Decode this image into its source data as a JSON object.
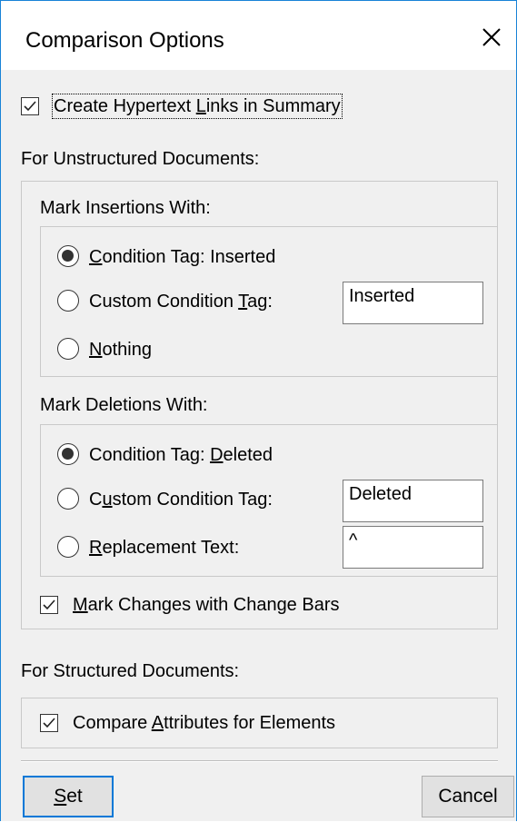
{
  "dialog": {
    "title": "Comparison Options",
    "close_icon": "close-icon"
  },
  "create_links": {
    "checked": true,
    "label_pre": "Create Hypertext ",
    "label_key": "L",
    "label_post": "inks in Summary"
  },
  "unstructured": {
    "heading": "For Unstructured Documents:",
    "insertions": {
      "heading": "Mark Insertions With:",
      "opt1": {
        "selected": true,
        "key": "C",
        "post": "ondition Tag: Inserted"
      },
      "opt2": {
        "selected": false,
        "pre": "Custom Condition ",
        "key": "T",
        "post": "ag:",
        "value": "Inserted"
      },
      "opt3": {
        "selected": false,
        "key": "N",
        "post": "othing"
      }
    },
    "deletions": {
      "heading": "Mark Deletions With:",
      "opt1": {
        "selected": true,
        "pre": "Condition Tag: ",
        "key": "D",
        "post": "eleted"
      },
      "opt2": {
        "selected": false,
        "pre": "C",
        "key": "u",
        "post": "stom Condition Tag:",
        "value": "Deleted"
      },
      "opt3": {
        "selected": false,
        "key": "R",
        "post": "eplacement Text:",
        "value": "^"
      }
    },
    "change_bars": {
      "checked": true,
      "key": "M",
      "post": "ark Changes with Change Bars"
    }
  },
  "structured": {
    "heading": "For Structured Documents:",
    "compare_attrs": {
      "checked": true,
      "pre": "Compare ",
      "key": "A",
      "post": "ttributes for Elements"
    }
  },
  "buttons": {
    "set": {
      "key": "S",
      "post": "et"
    },
    "cancel": "Cancel"
  },
  "colors": {
    "accent": "#0078d7",
    "border": "#1883d7",
    "dialog_bg": "#f0f0f0"
  }
}
